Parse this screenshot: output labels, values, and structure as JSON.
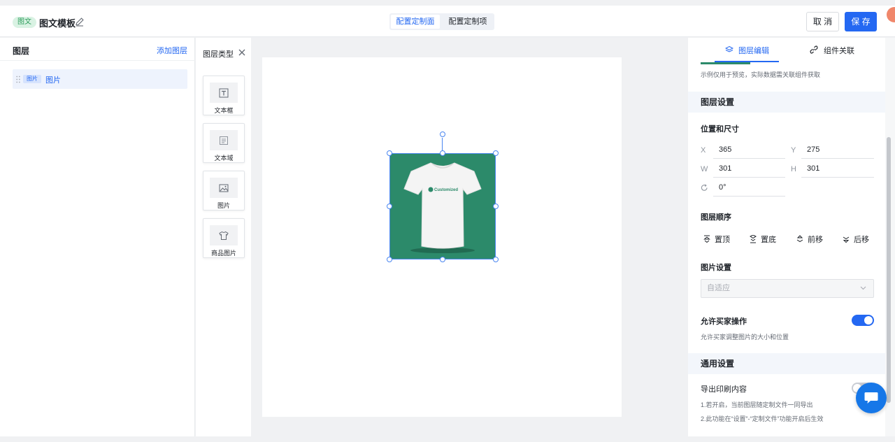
{
  "header": {
    "badge": "图文",
    "title": "图文模板",
    "segments": [
      "配置定制面",
      "配置定制项"
    ],
    "cancel_label": "取 消",
    "save_label": "保 存"
  },
  "layers": {
    "title": "图层",
    "add_label": "添加图层",
    "items": [
      {
        "tag": "图片",
        "name": "图片"
      }
    ]
  },
  "layer_types": {
    "title": "图层类型",
    "items": [
      {
        "label": "文本框",
        "icon": "text-box-icon"
      },
      {
        "label": "文本域",
        "icon": "text-area-icon"
      },
      {
        "label": "图片",
        "icon": "image-icon"
      },
      {
        "label": "商品图片",
        "icon": "tshirt-icon"
      }
    ]
  },
  "canvas": {
    "shirt_text": "Customized",
    "background_color": "#2c8a6a"
  },
  "right": {
    "tabs": [
      "图层编辑",
      "组件关联"
    ],
    "hint": "示例仅用于预览，实际数据需关联组件获取",
    "layer_settings_title": "图层设置",
    "position_title": "位置和尺寸",
    "x_label": "X",
    "x_value": "365",
    "y_label": "Y",
    "y_value": "275",
    "w_label": "W",
    "w_value": "301",
    "h_label": "H",
    "h_value": "301",
    "rotation_value": "0°",
    "order_title": "图层顺序",
    "order_buttons": [
      "置顶",
      "置底",
      "前移",
      "后移"
    ],
    "image_settings_title": "图片设置",
    "image_fit_placeholder": "自适应",
    "allow_buyer_title": "允许买家操作",
    "allow_buyer_desc": "允许买家调整图片的大小和位置",
    "allow_buyer_on": true,
    "general_title": "通用设置",
    "export_title": "导出印刷内容",
    "export_on": false,
    "note1": "1.若开启，当前图层随定制文件一同导出",
    "note2": "2.此功能在“设置”-“定制文件”功能开启后生效"
  },
  "colors": {
    "accent": "#2468f2",
    "brand_green": "#2c8a6a"
  }
}
